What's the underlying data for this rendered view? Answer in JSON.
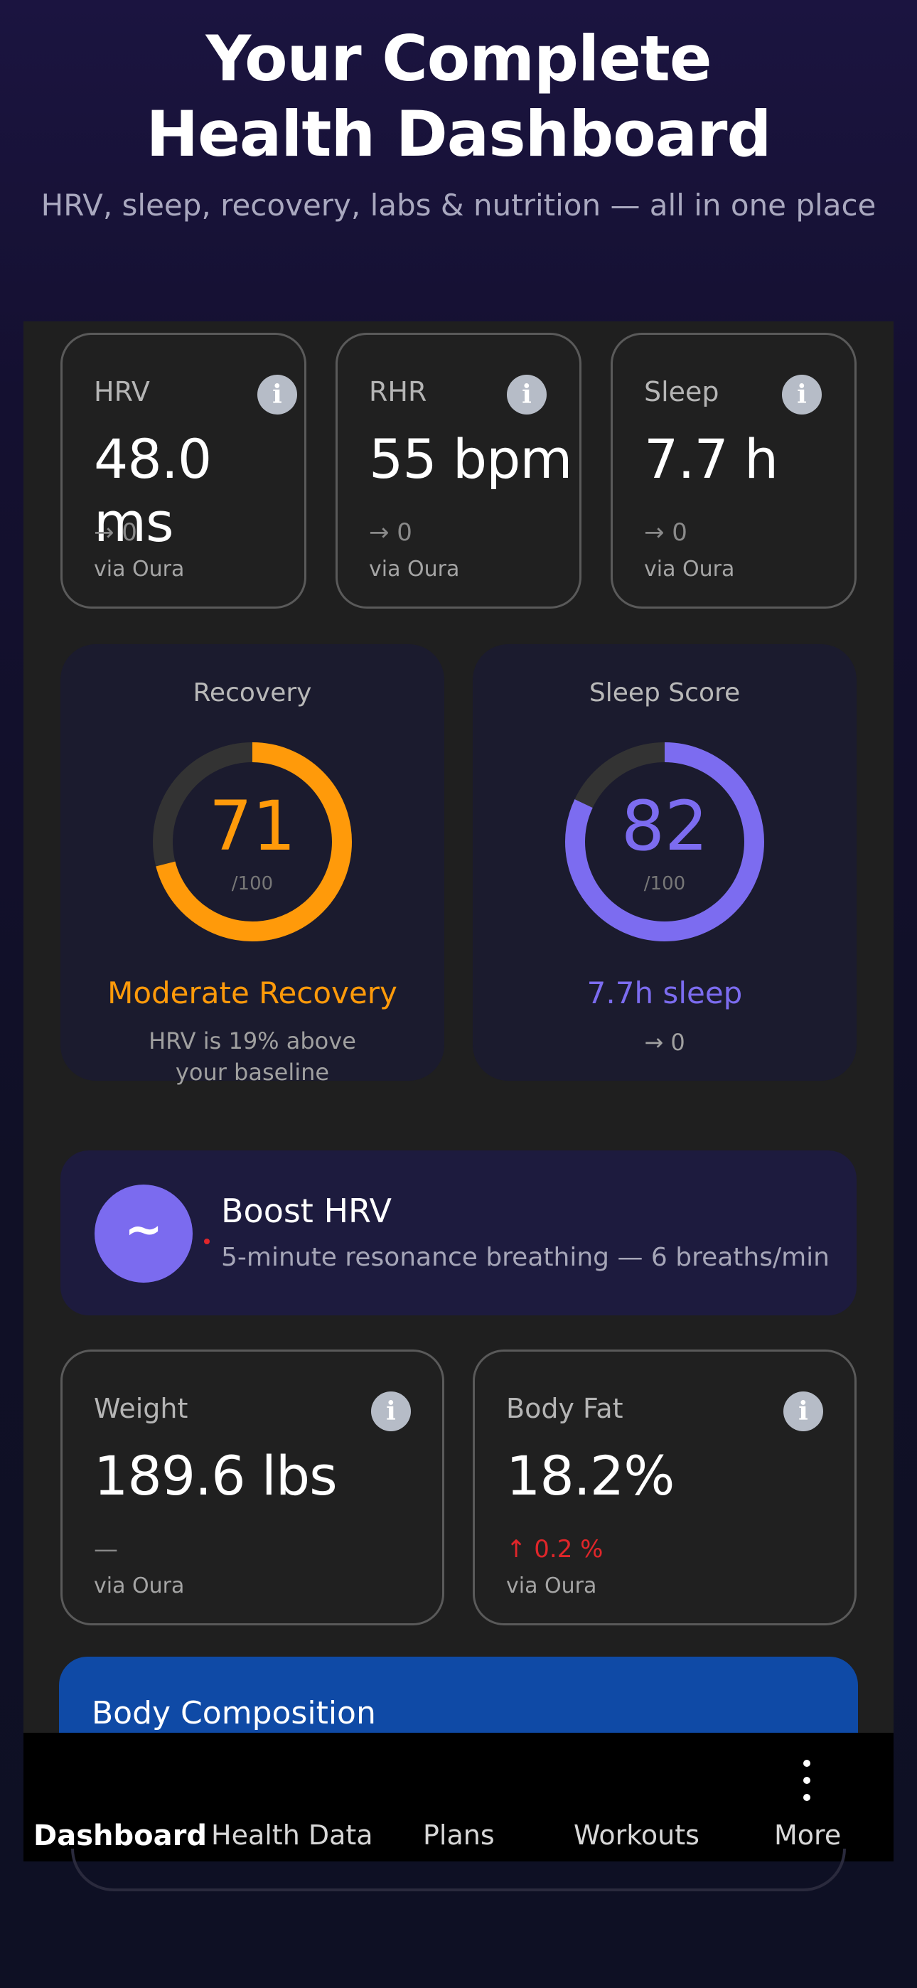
{
  "hero": {
    "title_line1": "Your Complete",
    "title_line2": "Health Dashboard",
    "subtitle": "HRV, sleep, recovery, labs & nutrition — all in one place"
  },
  "metrics_top": [
    {
      "label": "HRV",
      "value": "48.0 ms",
      "trend": "→ 0",
      "source": "via Oura"
    },
    {
      "label": "RHR",
      "value": "55 bpm",
      "trend": "→ 0",
      "source": "via Oura"
    },
    {
      "label": "Sleep",
      "value": "7.7 h",
      "trend": "→ 0",
      "source": "via Oura"
    }
  ],
  "info_glyph": "i",
  "recovery": {
    "title": "Recovery",
    "score": "71",
    "score_value": 71,
    "max": "/100",
    "status": "Moderate Recovery",
    "description": "HRV is 19% above your baseline",
    "color": "#ff9a0a"
  },
  "sleep_score": {
    "title": "Sleep Score",
    "score": "82",
    "score_value": 82,
    "max": "/100",
    "status": "7.7h sleep",
    "trend": "→ 0",
    "color": "#7c6cf0"
  },
  "boost": {
    "icon_glyph": "~",
    "title": "Boost HRV",
    "subtitle": "5-minute resonance breathing — 6 breaths/min"
  },
  "metrics_body": [
    {
      "label": "Weight",
      "value": "189.6 lbs",
      "trend": "—",
      "source": "via Oura"
    },
    {
      "label": "Body Fat",
      "value": "18.2%",
      "trend": "↑ 0.2 %",
      "source": "via Oura"
    }
  ],
  "body_composition": {
    "title": "Body Composition"
  },
  "nav": {
    "items": [
      "Dashboard",
      "Health Data",
      "Plans",
      "Workouts",
      "More"
    ],
    "active": "Dashboard"
  },
  "colors": {
    "background": "#1f1f1f",
    "accent_orange": "#ff9a0a",
    "accent_purple": "#7c6cf0",
    "trend_up_red": "#e0262a",
    "body_comp_blue": "#0f4aa6"
  }
}
